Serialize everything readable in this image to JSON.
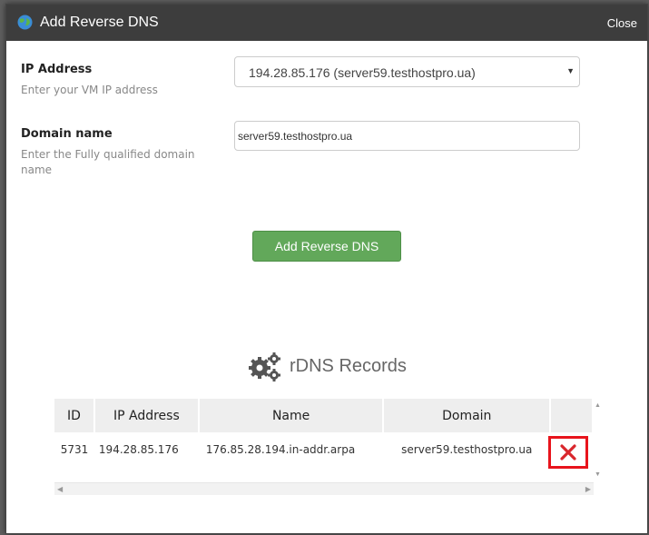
{
  "dialog": {
    "title": "Add Reverse DNS",
    "close_label": "Close"
  },
  "form": {
    "ip_label": "IP Address",
    "ip_hint": "Enter your VM IP address",
    "ip_selected": "194.28.85.176 (server59.testhostpro.ua)",
    "domain_label": "Domain name",
    "domain_hint": "Enter the Fully qualified domain name",
    "domain_value": "server59.testhostpro.ua",
    "submit_label": "Add Reverse DNS"
  },
  "records": {
    "title": "rDNS Records",
    "columns": [
      "ID",
      "IP Address",
      "Name",
      "Domain",
      ""
    ],
    "rows": [
      {
        "id": "5731",
        "ip": "194.28.85.176",
        "name": "176.85.28.194.in-addr.arpa",
        "domain": "server59.testhostpro.ua"
      }
    ]
  },
  "colors": {
    "header_bg": "#3d3d3d",
    "primary_btn": "#62a85a",
    "delete_outline": "#e8141c"
  },
  "icons": {
    "title_icon": "globe-icon",
    "section_icon": "gears-icon",
    "delete_icon": "close-x-icon"
  }
}
